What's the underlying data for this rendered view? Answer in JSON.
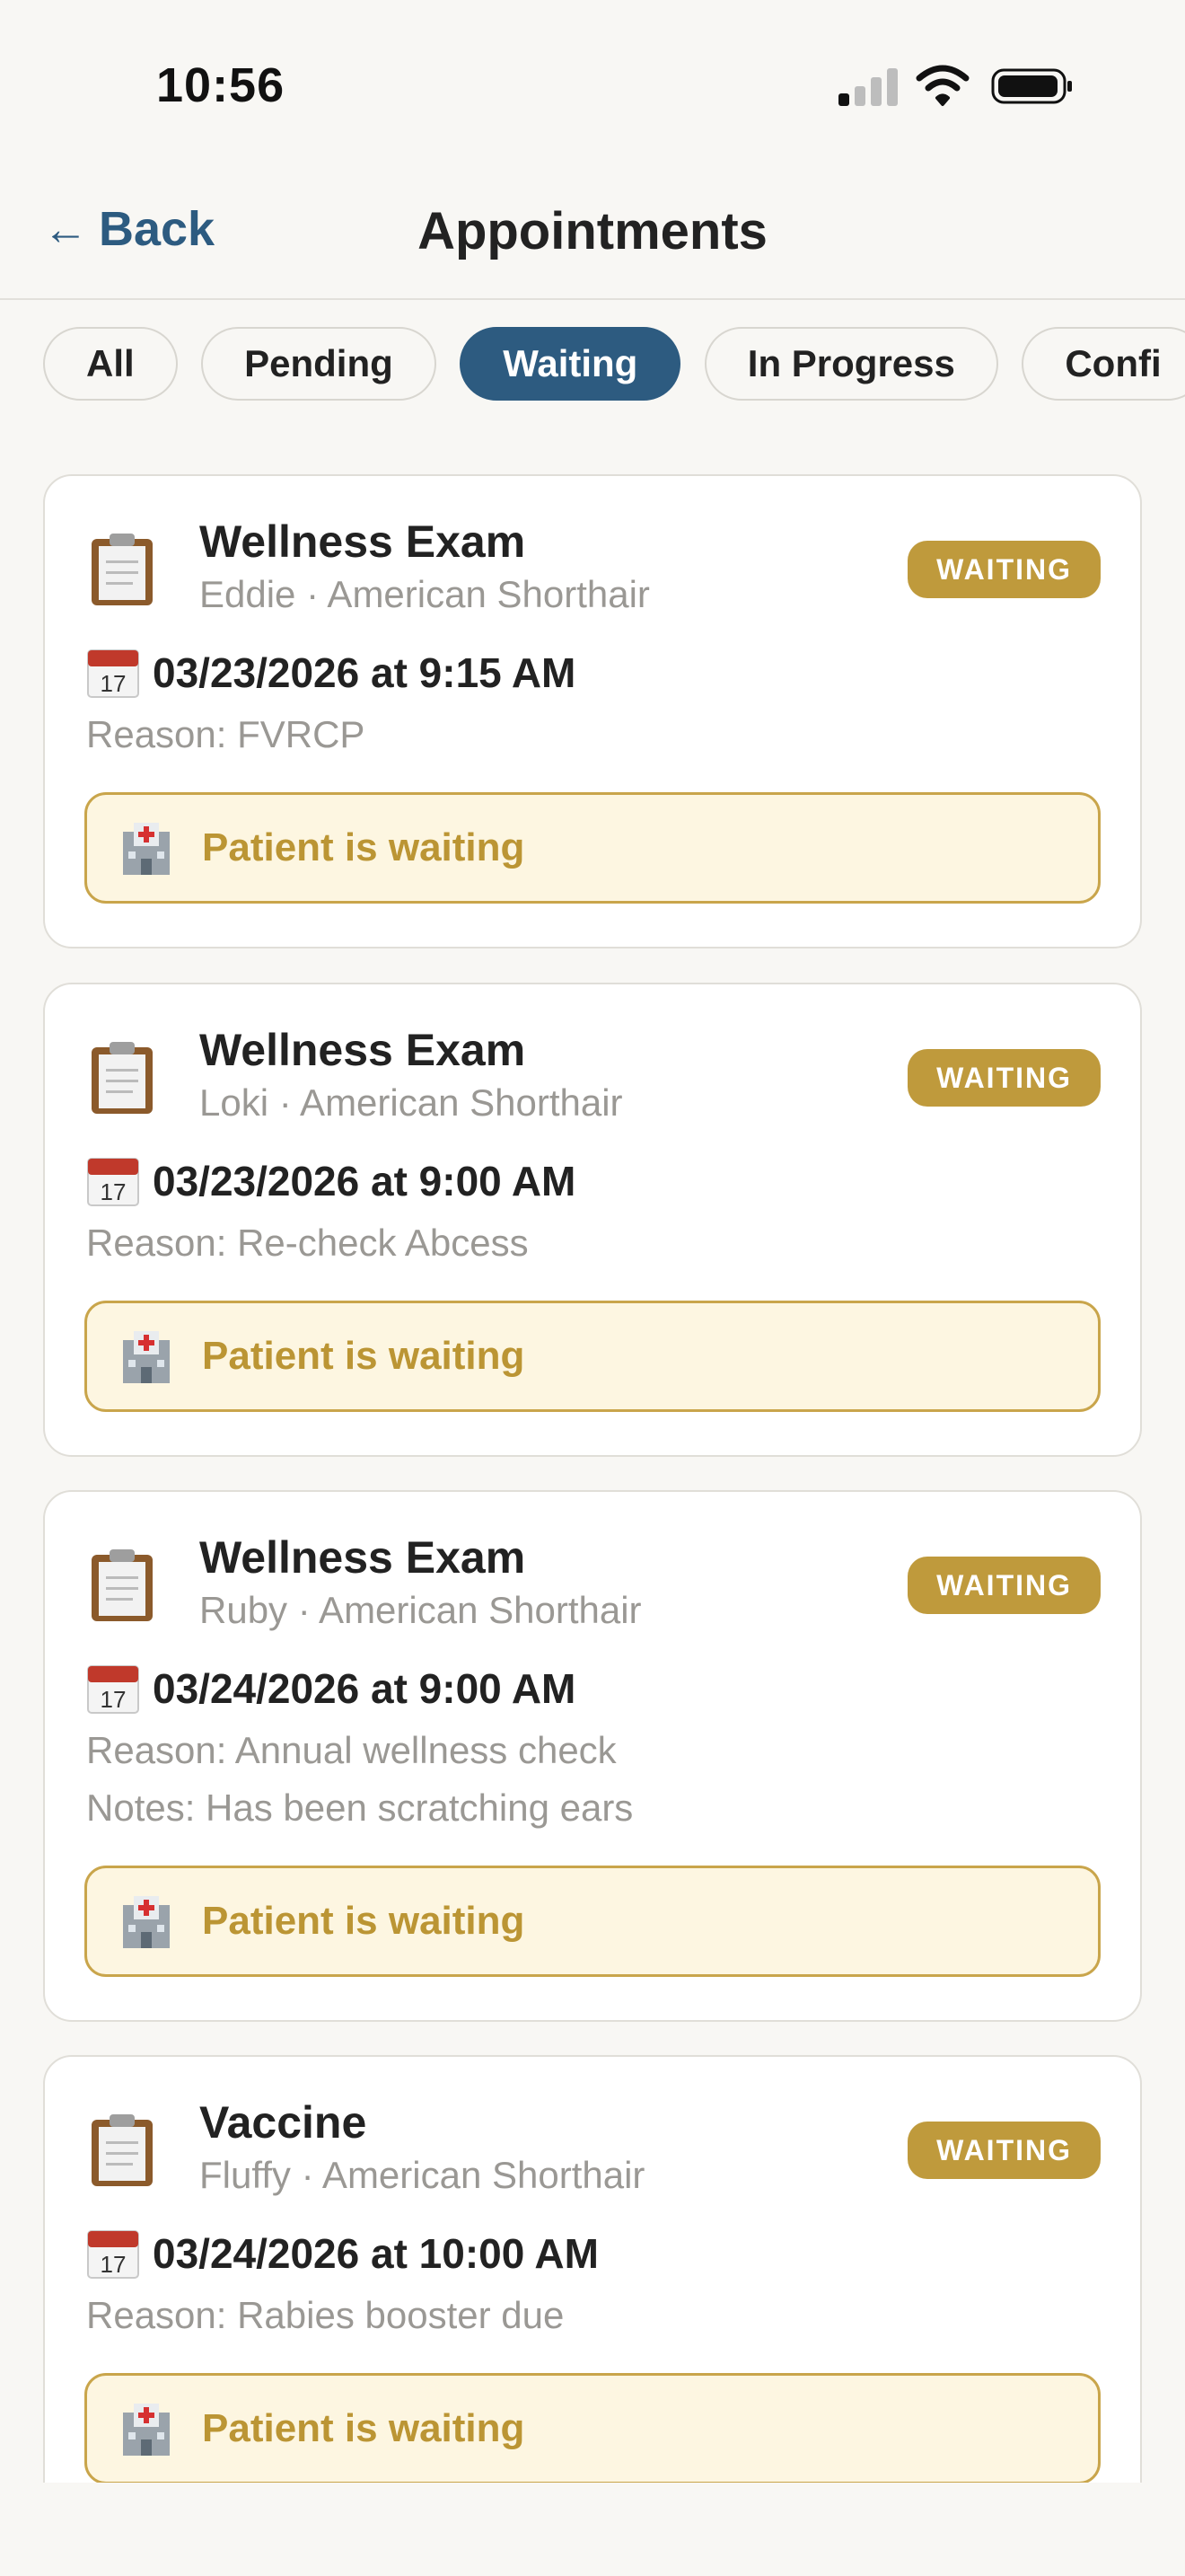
{
  "status_bar": {
    "time": "10:56"
  },
  "nav": {
    "back_label": "Back",
    "title": "Appointments"
  },
  "filters": {
    "all": "All",
    "pending": "Pending",
    "waiting": "Waiting",
    "in_progress": "In Progress",
    "confirmed": "Confi",
    "selected": "Waiting"
  },
  "appointments": [
    {
      "title": "Wellness Exam",
      "subtitle": "Eddie · American Shorthair",
      "badge": "WAITING",
      "datetime": "03/23/2026 at 9:15 AM",
      "reason": "Reason: FVRCP",
      "notes": "",
      "status_text": "Patient is waiting"
    },
    {
      "title": "Wellness Exam",
      "subtitle": "Loki · American Shorthair",
      "badge": "WAITING",
      "datetime": "03/23/2026 at 9:00 AM",
      "reason": "Reason: Re-check Abcess",
      "notes": "",
      "status_text": "Patient is waiting"
    },
    {
      "title": "Wellness Exam",
      "subtitle": "Ruby · American Shorthair",
      "badge": "WAITING",
      "datetime": "03/24/2026 at 9:00 AM",
      "reason": "Reason: Annual wellness check",
      "notes": "Notes: Has been scratching ears",
      "status_text": "Patient is waiting"
    },
    {
      "title": "Vaccine",
      "subtitle": "Fluffy · American Shorthair",
      "badge": "WAITING",
      "datetime": "03/24/2026 at 10:00 AM",
      "reason": "Reason: Rabies booster due",
      "notes": "",
      "status_text": "Patient is waiting"
    }
  ],
  "colors": {
    "accent": "#2d5b80",
    "badge": "#bf9a3c",
    "waiting_bg": "#fdf6e1",
    "waiting_text": "#bb9534"
  },
  "icons": [
    "back-arrow-icon",
    "clipboard-icon",
    "calendar-icon",
    "hospital-icon"
  ]
}
